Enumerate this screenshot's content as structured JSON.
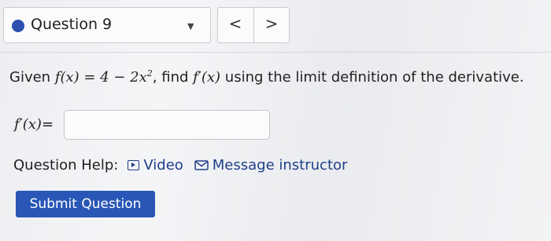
{
  "header": {
    "question_label": "Question 9",
    "prev_label": "<",
    "next_label": ">"
  },
  "question": {
    "prefix": "Given ",
    "function_expr": "f(x) = 4 − 2x",
    "exponent": "2",
    "middle": ", find ",
    "derivative_expr": "f′(x)",
    "suffix": " using the limit definition of the derivative."
  },
  "answer": {
    "label_expr": "f′(x)",
    "label_suffix": "=",
    "value": "",
    "placeholder": ""
  },
  "help": {
    "label": "Question Help:",
    "video_label": "Video",
    "message_label": "Message instructor"
  },
  "submit_label": "Submit Question",
  "colors": {
    "accent": "#2a57b7",
    "status_dot": "#2c4fb0",
    "link": "#1f3f8a"
  }
}
